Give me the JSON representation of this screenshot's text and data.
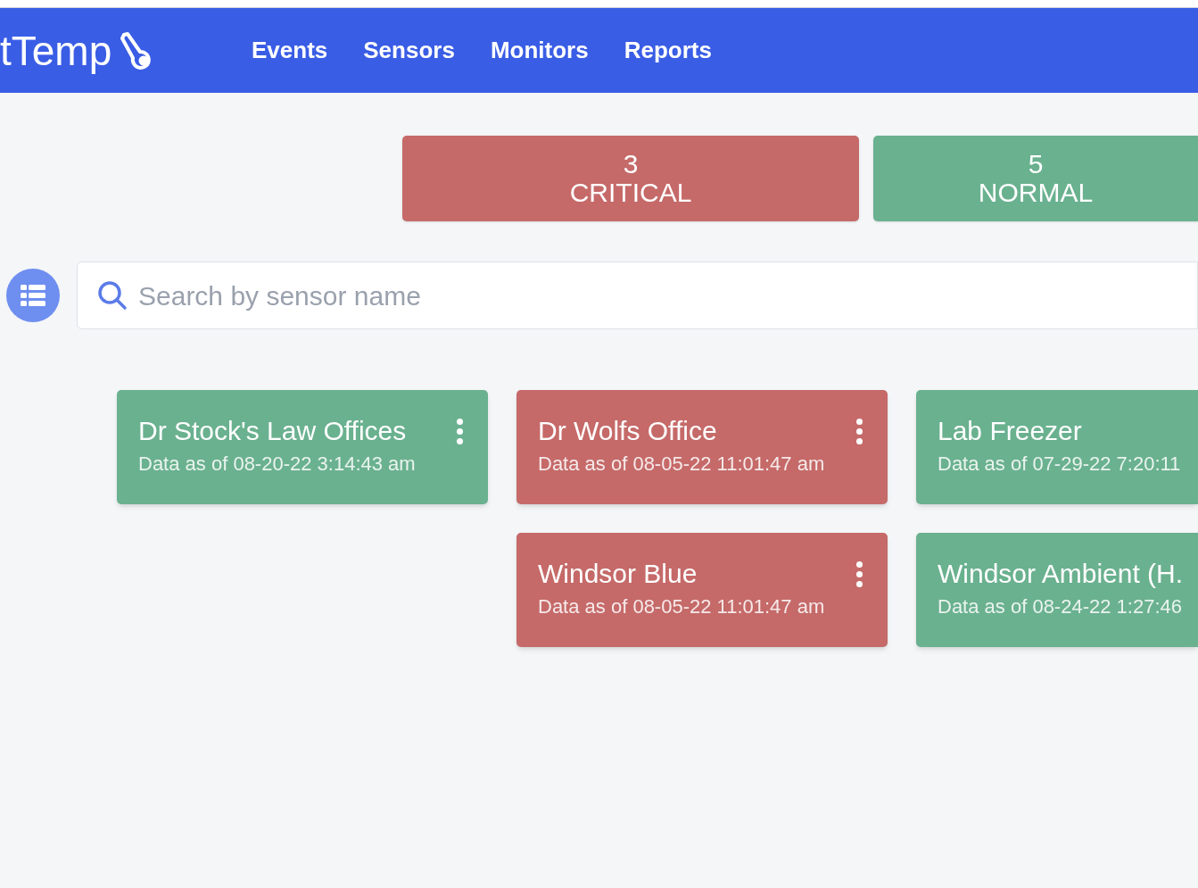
{
  "brand": "tTemp",
  "nav": [
    {
      "label": "Events"
    },
    {
      "label": "Sensors"
    },
    {
      "label": "Monitors"
    },
    {
      "label": "Reports"
    }
  ],
  "summary": [
    {
      "count": "3",
      "label": "CRITICAL",
      "color": "#c56a69"
    },
    {
      "count": "5",
      "label": "NORMAL",
      "color": "#6ab18f"
    }
  ],
  "search": {
    "placeholder": "Search by sensor name"
  },
  "columns": [
    {
      "cards": [
        {
          "name": "Dr Stock's Law Offices",
          "updated": "Data as of 08-20-22 3:14:43 am",
          "color": "#6ab18f",
          "menu_button": true
        }
      ]
    },
    {
      "cards": [
        {
          "name": "Dr Wolfs Office",
          "updated": "Data as of 08-05-22 11:01:47 am",
          "color": "#c56a69",
          "menu_button": true
        },
        {
          "name": "Windsor Blue",
          "updated": "Data as of 08-05-22 11:01:47 am",
          "color": "#c56a69",
          "menu_button": true
        }
      ]
    },
    {
      "cards": [
        {
          "name": "Lab Freezer",
          "updated": "Data as of 07-29-22 7:20:11",
          "color": "#6ab18f",
          "menu_button": false
        },
        {
          "name": "Windsor Ambient (H.",
          "updated": "Data as of 08-24-22 1:27:46",
          "color": "#6ab18f",
          "menu_button": false
        }
      ]
    }
  ]
}
